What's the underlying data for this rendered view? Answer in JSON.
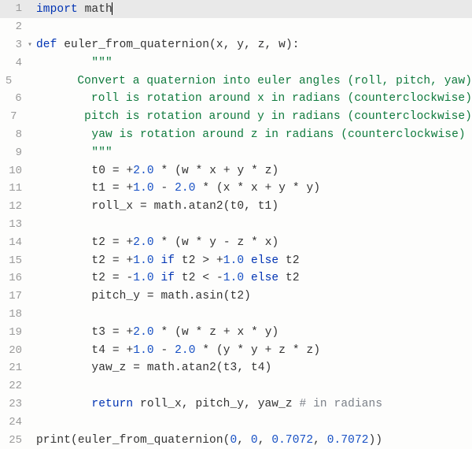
{
  "lines": [
    {
      "n": "1",
      "fold": "",
      "hl": true,
      "tokens": [
        [
          "kw",
          "import"
        ],
        [
          "sp",
          " "
        ],
        [
          "mod",
          "math"
        ]
      ],
      "cursor_after": true
    },
    {
      "n": "2",
      "fold": "",
      "tokens": []
    },
    {
      "n": "3",
      "fold": "▾",
      "tokens": [
        [
          "kw",
          "def"
        ],
        [
          "sp",
          " "
        ],
        [
          "fn",
          "euler_from_quaternion"
        ],
        [
          "par",
          "("
        ],
        [
          "id",
          "x"
        ],
        [
          "op",
          ", "
        ],
        [
          "id",
          "y"
        ],
        [
          "op",
          ", "
        ],
        [
          "id",
          "z"
        ],
        [
          "op",
          ", "
        ],
        [
          "id",
          "w"
        ],
        [
          "par",
          ")"
        ],
        [
          "op",
          ":"
        ]
      ]
    },
    {
      "n": "4",
      "fold": "",
      "tokens": [
        [
          "sp",
          "        "
        ],
        [
          "str",
          "\"\"\""
        ]
      ]
    },
    {
      "n": "5",
      "fold": "",
      "tokens": [
        [
          "sp",
          "        "
        ],
        [
          "str",
          "Convert a quaternion into euler angles (roll, pitch, yaw)"
        ]
      ]
    },
    {
      "n": "6",
      "fold": "",
      "tokens": [
        [
          "sp",
          "        "
        ],
        [
          "str",
          "roll is rotation around x in radians (counterclockwise)"
        ]
      ]
    },
    {
      "n": "7",
      "fold": "",
      "tokens": [
        [
          "sp",
          "        "
        ],
        [
          "str",
          "pitch is rotation around y in radians (counterclockwise)"
        ]
      ]
    },
    {
      "n": "8",
      "fold": "",
      "tokens": [
        [
          "sp",
          "        "
        ],
        [
          "str",
          "yaw is rotation around z in radians (counterclockwise)"
        ]
      ]
    },
    {
      "n": "9",
      "fold": "",
      "tokens": [
        [
          "sp",
          "        "
        ],
        [
          "str",
          "\"\"\""
        ]
      ]
    },
    {
      "n": "10",
      "fold": "",
      "tokens": [
        [
          "sp",
          "        "
        ],
        [
          "id",
          "t0"
        ],
        [
          "sp",
          " "
        ],
        [
          "op",
          "="
        ],
        [
          "sp",
          " "
        ],
        [
          "op",
          "+"
        ],
        [
          "num",
          "2.0"
        ],
        [
          "sp",
          " "
        ],
        [
          "op",
          "*"
        ],
        [
          "sp",
          " "
        ],
        [
          "par",
          "("
        ],
        [
          "id",
          "w"
        ],
        [
          "sp",
          " "
        ],
        [
          "op",
          "*"
        ],
        [
          "sp",
          " "
        ],
        [
          "id",
          "x"
        ],
        [
          "sp",
          " "
        ],
        [
          "op",
          "+"
        ],
        [
          "sp",
          " "
        ],
        [
          "id",
          "y"
        ],
        [
          "sp",
          " "
        ],
        [
          "op",
          "*"
        ],
        [
          "sp",
          " "
        ],
        [
          "id",
          "z"
        ],
        [
          "par",
          ")"
        ]
      ]
    },
    {
      "n": "11",
      "fold": "",
      "tokens": [
        [
          "sp",
          "        "
        ],
        [
          "id",
          "t1"
        ],
        [
          "sp",
          " "
        ],
        [
          "op",
          "="
        ],
        [
          "sp",
          " "
        ],
        [
          "op",
          "+"
        ],
        [
          "num",
          "1.0"
        ],
        [
          "sp",
          " "
        ],
        [
          "op",
          "-"
        ],
        [
          "sp",
          " "
        ],
        [
          "num",
          "2.0"
        ],
        [
          "sp",
          " "
        ],
        [
          "op",
          "*"
        ],
        [
          "sp",
          " "
        ],
        [
          "par",
          "("
        ],
        [
          "id",
          "x"
        ],
        [
          "sp",
          " "
        ],
        [
          "op",
          "*"
        ],
        [
          "sp",
          " "
        ],
        [
          "id",
          "x"
        ],
        [
          "sp",
          " "
        ],
        [
          "op",
          "+"
        ],
        [
          "sp",
          " "
        ],
        [
          "id",
          "y"
        ],
        [
          "sp",
          " "
        ],
        [
          "op",
          "*"
        ],
        [
          "sp",
          " "
        ],
        [
          "id",
          "y"
        ],
        [
          "par",
          ")"
        ]
      ]
    },
    {
      "n": "12",
      "fold": "",
      "tokens": [
        [
          "sp",
          "        "
        ],
        [
          "id",
          "roll_x"
        ],
        [
          "sp",
          " "
        ],
        [
          "op",
          "="
        ],
        [
          "sp",
          " "
        ],
        [
          "id",
          "math"
        ],
        [
          "dot",
          "."
        ],
        [
          "id",
          "atan2"
        ],
        [
          "par",
          "("
        ],
        [
          "id",
          "t0"
        ],
        [
          "op",
          ", "
        ],
        [
          "id",
          "t1"
        ],
        [
          "par",
          ")"
        ]
      ]
    },
    {
      "n": "13",
      "fold": "",
      "tokens": []
    },
    {
      "n": "14",
      "fold": "",
      "tokens": [
        [
          "sp",
          "        "
        ],
        [
          "id",
          "t2"
        ],
        [
          "sp",
          " "
        ],
        [
          "op",
          "="
        ],
        [
          "sp",
          " "
        ],
        [
          "op",
          "+"
        ],
        [
          "num",
          "2.0"
        ],
        [
          "sp",
          " "
        ],
        [
          "op",
          "*"
        ],
        [
          "sp",
          " "
        ],
        [
          "par",
          "("
        ],
        [
          "id",
          "w"
        ],
        [
          "sp",
          " "
        ],
        [
          "op",
          "*"
        ],
        [
          "sp",
          " "
        ],
        [
          "id",
          "y"
        ],
        [
          "sp",
          " "
        ],
        [
          "op",
          "-"
        ],
        [
          "sp",
          " "
        ],
        [
          "id",
          "z"
        ],
        [
          "sp",
          " "
        ],
        [
          "op",
          "*"
        ],
        [
          "sp",
          " "
        ],
        [
          "id",
          "x"
        ],
        [
          "par",
          ")"
        ]
      ]
    },
    {
      "n": "15",
      "fold": "",
      "tokens": [
        [
          "sp",
          "        "
        ],
        [
          "id",
          "t2"
        ],
        [
          "sp",
          " "
        ],
        [
          "op",
          "="
        ],
        [
          "sp",
          " "
        ],
        [
          "op",
          "+"
        ],
        [
          "num",
          "1.0"
        ],
        [
          "sp",
          " "
        ],
        [
          "kw",
          "if"
        ],
        [
          "sp",
          " "
        ],
        [
          "id",
          "t2"
        ],
        [
          "sp",
          " "
        ],
        [
          "op",
          ">"
        ],
        [
          "sp",
          " "
        ],
        [
          "op",
          "+"
        ],
        [
          "num",
          "1.0"
        ],
        [
          "sp",
          " "
        ],
        [
          "kw",
          "else"
        ],
        [
          "sp",
          " "
        ],
        [
          "id",
          "t2"
        ]
      ]
    },
    {
      "n": "16",
      "fold": "",
      "tokens": [
        [
          "sp",
          "        "
        ],
        [
          "id",
          "t2"
        ],
        [
          "sp",
          " "
        ],
        [
          "op",
          "="
        ],
        [
          "sp",
          " "
        ],
        [
          "op",
          "-"
        ],
        [
          "num",
          "1.0"
        ],
        [
          "sp",
          " "
        ],
        [
          "kw",
          "if"
        ],
        [
          "sp",
          " "
        ],
        [
          "id",
          "t2"
        ],
        [
          "sp",
          " "
        ],
        [
          "op",
          "<"
        ],
        [
          "sp",
          " "
        ],
        [
          "op",
          "-"
        ],
        [
          "num",
          "1.0"
        ],
        [
          "sp",
          " "
        ],
        [
          "kw",
          "else"
        ],
        [
          "sp",
          " "
        ],
        [
          "id",
          "t2"
        ]
      ]
    },
    {
      "n": "17",
      "fold": "",
      "tokens": [
        [
          "sp",
          "        "
        ],
        [
          "id",
          "pitch_y"
        ],
        [
          "sp",
          " "
        ],
        [
          "op",
          "="
        ],
        [
          "sp",
          " "
        ],
        [
          "id",
          "math"
        ],
        [
          "dot",
          "."
        ],
        [
          "id",
          "asin"
        ],
        [
          "par",
          "("
        ],
        [
          "id",
          "t2"
        ],
        [
          "par",
          ")"
        ]
      ]
    },
    {
      "n": "18",
      "fold": "",
      "tokens": []
    },
    {
      "n": "19",
      "fold": "",
      "tokens": [
        [
          "sp",
          "        "
        ],
        [
          "id",
          "t3"
        ],
        [
          "sp",
          " "
        ],
        [
          "op",
          "="
        ],
        [
          "sp",
          " "
        ],
        [
          "op",
          "+"
        ],
        [
          "num",
          "2.0"
        ],
        [
          "sp",
          " "
        ],
        [
          "op",
          "*"
        ],
        [
          "sp",
          " "
        ],
        [
          "par",
          "("
        ],
        [
          "id",
          "w"
        ],
        [
          "sp",
          " "
        ],
        [
          "op",
          "*"
        ],
        [
          "sp",
          " "
        ],
        [
          "id",
          "z"
        ],
        [
          "sp",
          " "
        ],
        [
          "op",
          "+"
        ],
        [
          "sp",
          " "
        ],
        [
          "id",
          "x"
        ],
        [
          "sp",
          " "
        ],
        [
          "op",
          "*"
        ],
        [
          "sp",
          " "
        ],
        [
          "id",
          "y"
        ],
        [
          "par",
          ")"
        ]
      ]
    },
    {
      "n": "20",
      "fold": "",
      "tokens": [
        [
          "sp",
          "        "
        ],
        [
          "id",
          "t4"
        ],
        [
          "sp",
          " "
        ],
        [
          "op",
          "="
        ],
        [
          "sp",
          " "
        ],
        [
          "op",
          "+"
        ],
        [
          "num",
          "1.0"
        ],
        [
          "sp",
          " "
        ],
        [
          "op",
          "-"
        ],
        [
          "sp",
          " "
        ],
        [
          "num",
          "2.0"
        ],
        [
          "sp",
          " "
        ],
        [
          "op",
          "*"
        ],
        [
          "sp",
          " "
        ],
        [
          "par",
          "("
        ],
        [
          "id",
          "y"
        ],
        [
          "sp",
          " "
        ],
        [
          "op",
          "*"
        ],
        [
          "sp",
          " "
        ],
        [
          "id",
          "y"
        ],
        [
          "sp",
          " "
        ],
        [
          "op",
          "+"
        ],
        [
          "sp",
          " "
        ],
        [
          "id",
          "z"
        ],
        [
          "sp",
          " "
        ],
        [
          "op",
          "*"
        ],
        [
          "sp",
          " "
        ],
        [
          "id",
          "z"
        ],
        [
          "par",
          ")"
        ]
      ]
    },
    {
      "n": "21",
      "fold": "",
      "tokens": [
        [
          "sp",
          "        "
        ],
        [
          "id",
          "yaw_z"
        ],
        [
          "sp",
          " "
        ],
        [
          "op",
          "="
        ],
        [
          "sp",
          " "
        ],
        [
          "id",
          "math"
        ],
        [
          "dot",
          "."
        ],
        [
          "id",
          "atan2"
        ],
        [
          "par",
          "("
        ],
        [
          "id",
          "t3"
        ],
        [
          "op",
          ", "
        ],
        [
          "id",
          "t4"
        ],
        [
          "par",
          ")"
        ]
      ]
    },
    {
      "n": "22",
      "fold": "",
      "tokens": []
    },
    {
      "n": "23",
      "fold": "",
      "tokens": [
        [
          "sp",
          "        "
        ],
        [
          "kw",
          "return"
        ],
        [
          "sp",
          " "
        ],
        [
          "id",
          "roll_x"
        ],
        [
          "op",
          ", "
        ],
        [
          "id",
          "pitch_y"
        ],
        [
          "op",
          ", "
        ],
        [
          "id",
          "yaw_z"
        ],
        [
          "sp",
          " "
        ],
        [
          "com",
          "# in radians"
        ]
      ]
    },
    {
      "n": "24",
      "fold": "",
      "tokens": []
    },
    {
      "n": "25",
      "fold": "",
      "tokens": [
        [
          "bi",
          "print"
        ],
        [
          "par",
          "("
        ],
        [
          "id",
          "euler_from_quaternion"
        ],
        [
          "par",
          "("
        ],
        [
          "num",
          "0"
        ],
        [
          "op",
          ", "
        ],
        [
          "num",
          "0"
        ],
        [
          "op",
          ", "
        ],
        [
          "num",
          "0.7072"
        ],
        [
          "op",
          ", "
        ],
        [
          "num",
          "0.7072"
        ],
        [
          "par",
          ")"
        ],
        [
          "par",
          ")"
        ]
      ]
    }
  ]
}
